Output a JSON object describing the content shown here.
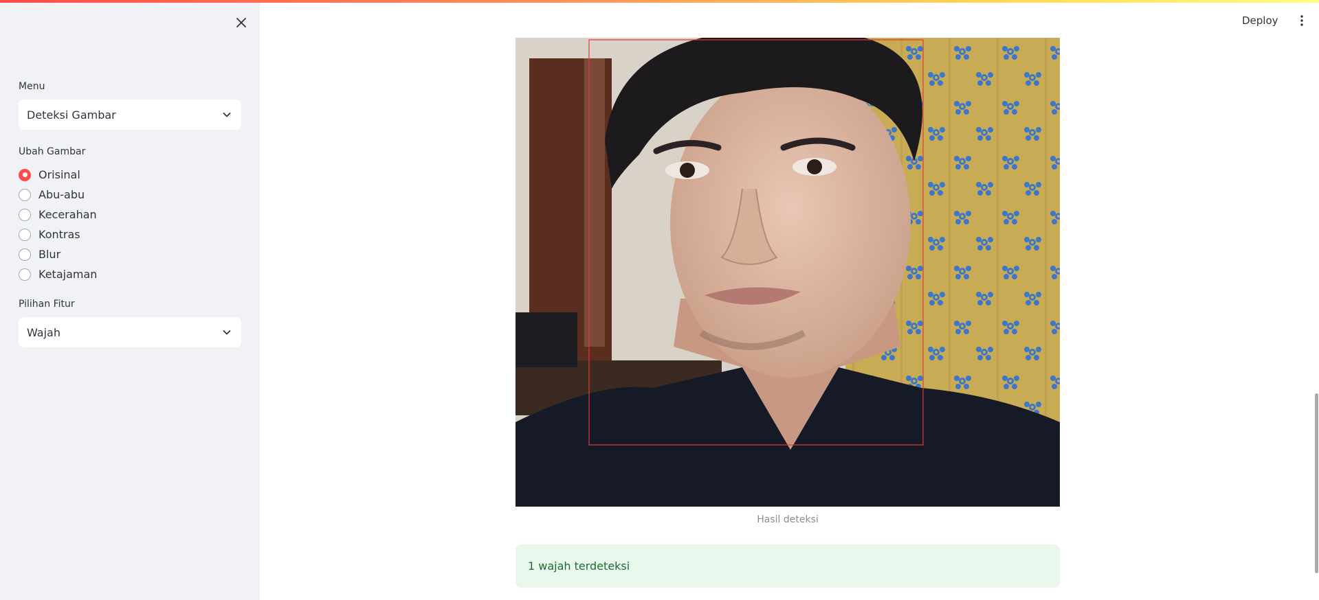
{
  "header": {
    "deploy_label": "Deploy"
  },
  "sidebar": {
    "menu_label": "Menu",
    "menu_selected": "Deteksi Gambar",
    "ubah_label": "Ubah Gambar",
    "radio_options": [
      "Orisinal",
      "Abu-abu",
      "Kecerahan",
      "Kontras",
      "Blur",
      "Ketajaman"
    ],
    "radio_selected_index": 0,
    "fitur_label": "Pilihan Fitur",
    "fitur_selected": "Wajah"
  },
  "main": {
    "caption": "Hasil deteksi",
    "alert_text": "1 wajah terdeteksi"
  },
  "colors": {
    "accent": "#ff4b4b",
    "sidebar_bg": "#f0f2f6",
    "success_bg": "#e8f8ec",
    "success_text": "#1e6b32",
    "detection_box": "#e03a3a"
  },
  "icons": {
    "close": "close-icon",
    "dropdown": "chevron-down-icon",
    "menu": "kebab-menu-icon"
  }
}
